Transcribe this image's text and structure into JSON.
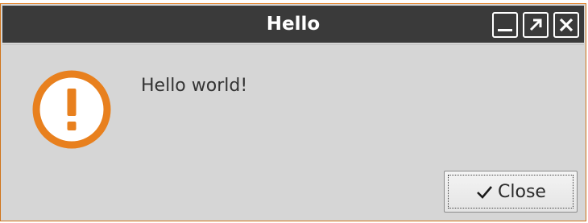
{
  "window": {
    "title": "Hello",
    "accent_color": "#e07a1a",
    "titlebar_color": "#3a3a3a",
    "controls": [
      {
        "icon": "minimize-icon"
      },
      {
        "icon": "maximize-icon"
      },
      {
        "icon": "close-icon"
      }
    ]
  },
  "dialog": {
    "icon": "warning-icon",
    "icon_color": "#e8801e",
    "message": "Hello world!",
    "close_button": {
      "label": "Close",
      "icon": "checkmark-icon"
    }
  }
}
